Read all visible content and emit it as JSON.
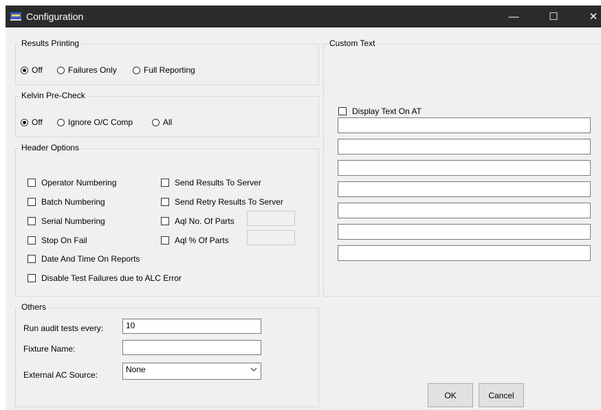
{
  "window": {
    "title": "Configuration"
  },
  "results_printing": {
    "legend": "Results Printing",
    "options": [
      "Off",
      "Failures Only",
      "Full Reporting"
    ],
    "selected": "Off"
  },
  "kelvin_precheck": {
    "legend": "Kelvin Pre-Check",
    "options": [
      "Off",
      "Ignore O/C Comp",
      "All"
    ],
    "selected": "Off"
  },
  "header_options": {
    "legend": "Header Options",
    "left_checks": [
      "Operator Numbering",
      "Batch Numbering",
      "Serial Numbering",
      "Stop On Fail",
      "Date And Time On Reports",
      "Disable Test Failures due to ALC Error"
    ],
    "right_checks": [
      "Send Results To Server",
      "Send Retry Results To Server",
      "Aql No. Of Parts",
      "Aql % Of Parts"
    ]
  },
  "others": {
    "legend": "Others",
    "audit_label": "Run audit tests every:",
    "audit_value": "10",
    "fixture_label": "Fixture Name:",
    "fixture_value": "",
    "ac_label": "External AC Source:",
    "ac_value": "None"
  },
  "custom_text": {
    "legend": "Custom Text",
    "display_label": "Display Text On AT",
    "lines": [
      "",
      "",
      "",
      "",
      "",
      "",
      ""
    ]
  },
  "buttons": {
    "ok": "OK",
    "cancel": "Cancel"
  },
  "icons": {
    "app": "app-icon",
    "minimize": "minimize-icon",
    "maximize": "maximize-icon",
    "close": "close-icon",
    "dropdown": "chevron-down-icon"
  }
}
